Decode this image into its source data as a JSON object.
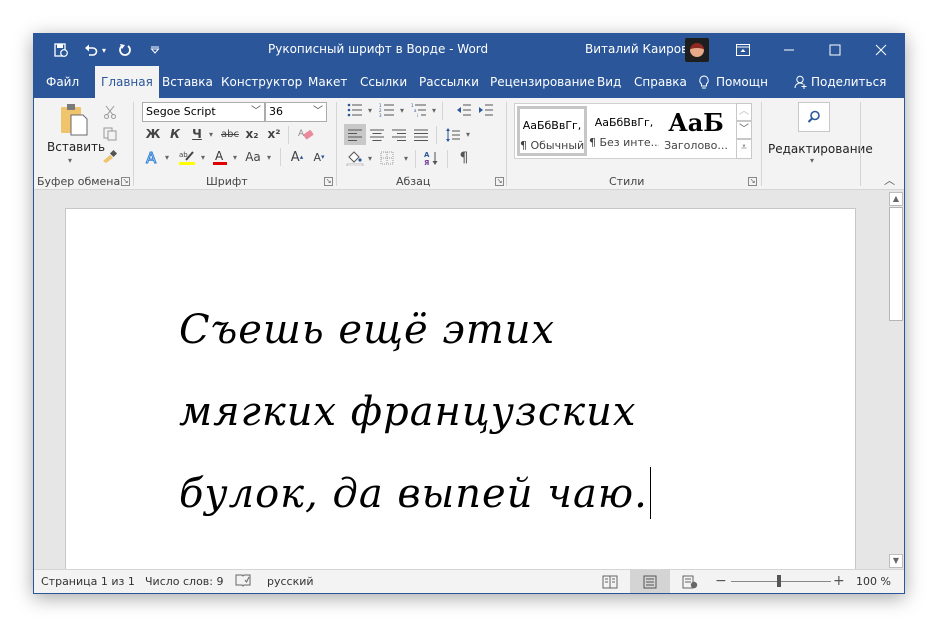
{
  "titlebar": {
    "title": "Рукописный шрифт в Ворде  -  Word",
    "user": "Виталий Каиров",
    "quick_access": {
      "autosave_icon": "autosave-icon",
      "undo_icon": "undo-icon",
      "redo_icon": "redo-icon",
      "customize_icon": "customize-qat-icon"
    },
    "buttons": [
      "ribbon-display-options",
      "minimize",
      "maximize",
      "close"
    ]
  },
  "tabs": [
    {
      "label": "Файл",
      "active": false
    },
    {
      "label": "Главная",
      "active": true
    },
    {
      "label": "Вставка",
      "active": false
    },
    {
      "label": "Конструктор",
      "active": false
    },
    {
      "label": "Макет",
      "active": false
    },
    {
      "label": "Ссылки",
      "active": false
    },
    {
      "label": "Рассылки",
      "active": false
    },
    {
      "label": "Рецензирование",
      "active": false
    },
    {
      "label": "Вид",
      "active": false
    },
    {
      "label": "Справка",
      "active": false
    },
    {
      "label": "Помощн",
      "active": false
    },
    {
      "label": "Поделиться",
      "active": false
    }
  ],
  "ribbon": {
    "clipboard": {
      "label": "Буфер обмена",
      "paste_label": "Вставить"
    },
    "font": {
      "label": "Шрифт",
      "font_name": "Segoe Script",
      "font_size": "36",
      "bold": "Ж",
      "italic": "К",
      "underline": "Ч",
      "strikethrough": "abc",
      "subscript": "x₂",
      "superscript": "x²",
      "change_case": "Aa",
      "highlight_color": "#ffff00",
      "font_color": "#e00000"
    },
    "paragraph": {
      "label": "Абзац",
      "active_alignment": "left"
    },
    "styles": {
      "label": "Стили",
      "items": [
        {
          "preview": "АаБбВвГг,",
          "name": "¶ Обычный",
          "selected": true
        },
        {
          "preview": "АаБбВвГг,",
          "name": "¶ Без инте...",
          "selected": false
        },
        {
          "preview": "АаБ",
          "name": "Заголово...",
          "selected": false
        }
      ]
    },
    "editing": {
      "label": "Редактирование"
    }
  },
  "document": {
    "lines": [
      "Съешь ещё этих",
      "мягких французских",
      "булок, да выпей чаю."
    ]
  },
  "statusbar": {
    "page": "Страница 1 из 1",
    "words": "Число слов: 9",
    "language": "русский",
    "zoom": "100 %",
    "zoom_percent": 100,
    "active_view": "print-layout"
  }
}
